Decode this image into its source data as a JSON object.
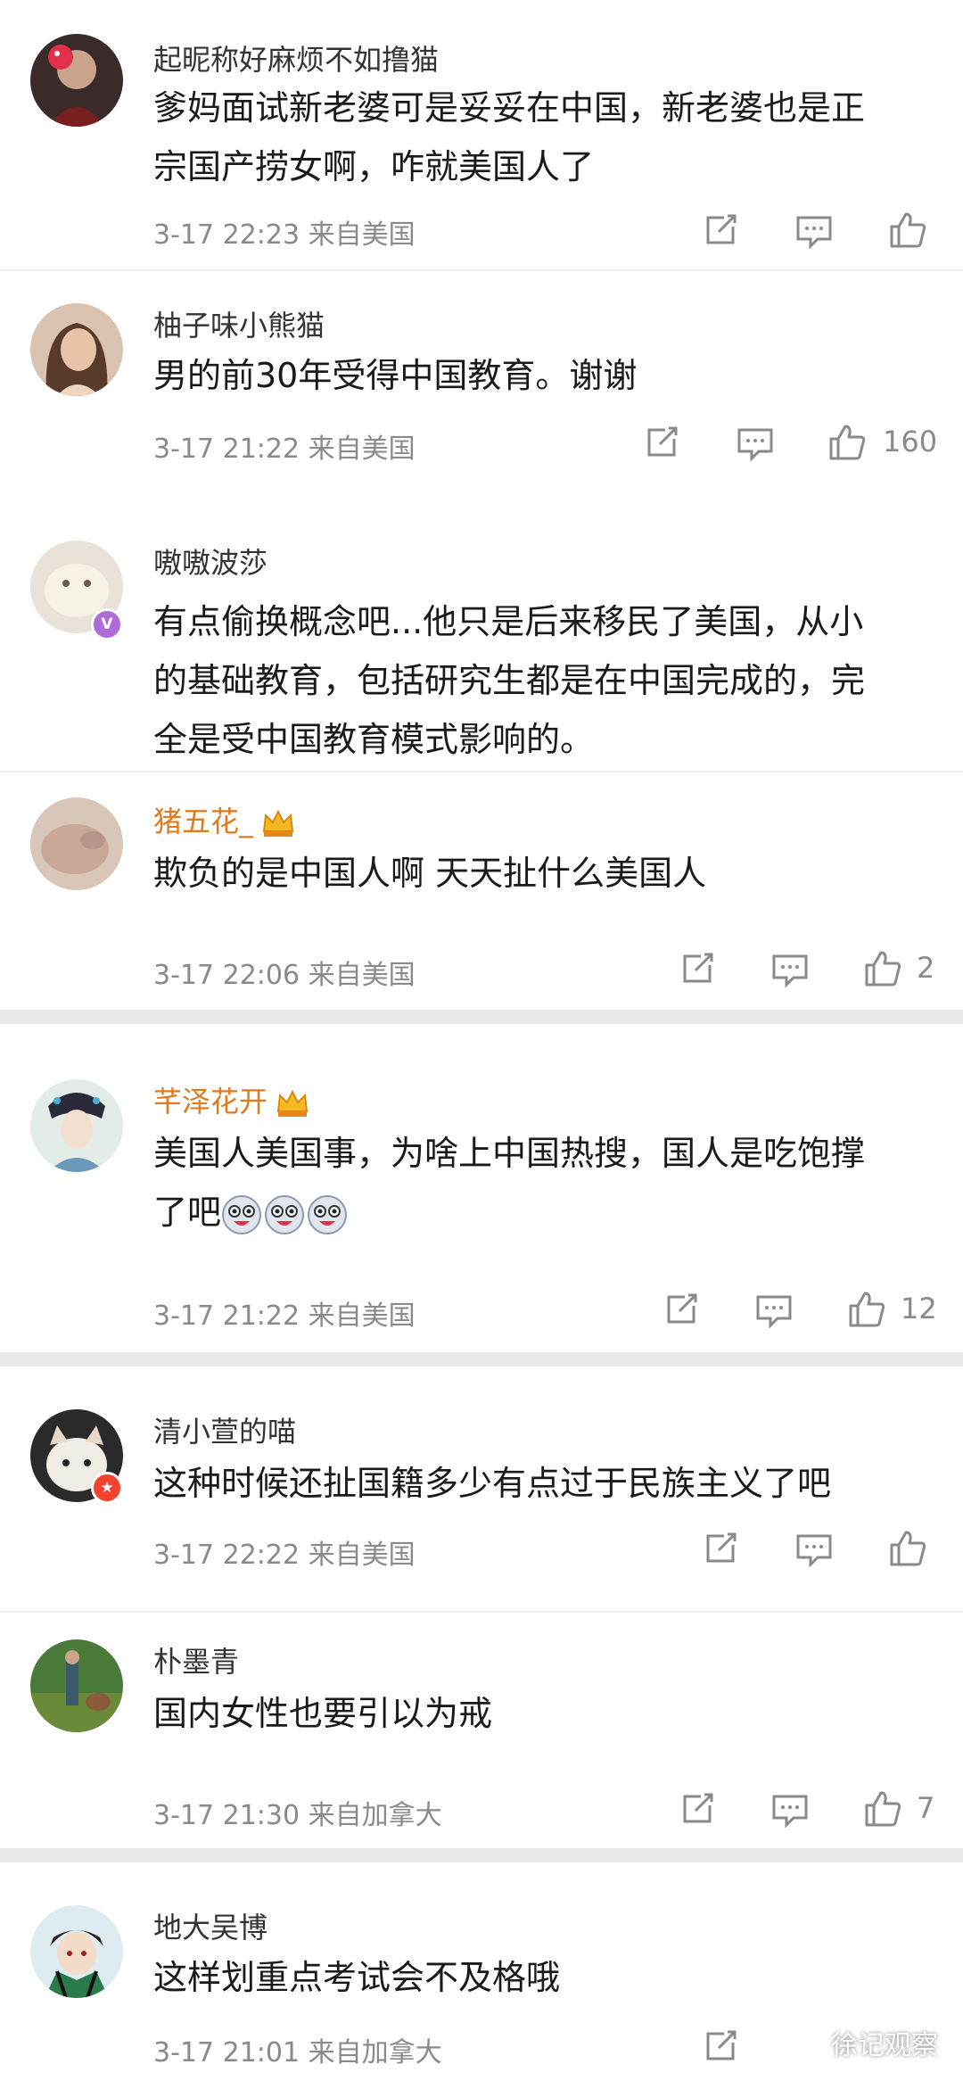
{
  "comments": [
    {
      "user": "起昵称好麻烦不如撸猫",
      "text": [
        "爹妈面试新老婆可是妥妥在中国，新老婆也是正",
        "宗国产捞女啊，咋就美国人了"
      ],
      "time": "3-17 22:23",
      "location": "来自美国",
      "likes": ""
    },
    {
      "user": "柚子味小熊猫",
      "text": [
        "男的前30年受得中国教育。谢谢"
      ],
      "time": "3-17 21:22",
      "location": "来自美国",
      "likes": "160"
    },
    {
      "user": "嗷嗷波莎",
      "text": [
        "有点偷换概念吧...他只是后来移民了美国，从小",
        "的基础教育，包括研究生都是在中国完成的，完",
        "全是受中国教育模式影响的。"
      ]
    },
    {
      "user": "猪五花_",
      "text": [
        "欺负的是中国人啊 天天扯什么美国人"
      ],
      "time": "3-17 22:06",
      "location": "来自美国",
      "likes": "2"
    },
    {
      "user": "芊泽花开",
      "text": [
        "美国人美国事，为啥上中国热搜，国人是吃饱撑",
        "了吧"
      ],
      "time": "3-17 21:22",
      "location": "来自美国",
      "likes": "12"
    },
    {
      "user": "清小萱的喵",
      "text": [
        "这种时候还扯国籍多少有点过于民族主义了吧"
      ],
      "time": "3-17 22:22",
      "location": "来自美国",
      "likes": ""
    },
    {
      "user": "朴墨青",
      "text": [
        "国内女性也要引以为戒"
      ],
      "time": "3-17 21:30",
      "location": "来自加拿大",
      "likes": "7"
    },
    {
      "user": "地大吴博",
      "text": [
        "这样划重点考试会不及格哦"
      ],
      "time": "3-17 21:01",
      "location": "来自加拿大",
      "likes": ""
    }
  ],
  "watermark": "徐记观察",
  "colors": {
    "vip_name": "#e07a1f",
    "meta": "#8a8a8a",
    "badge_red": "#f2432f",
    "badge_purple": "#b06ad9"
  }
}
